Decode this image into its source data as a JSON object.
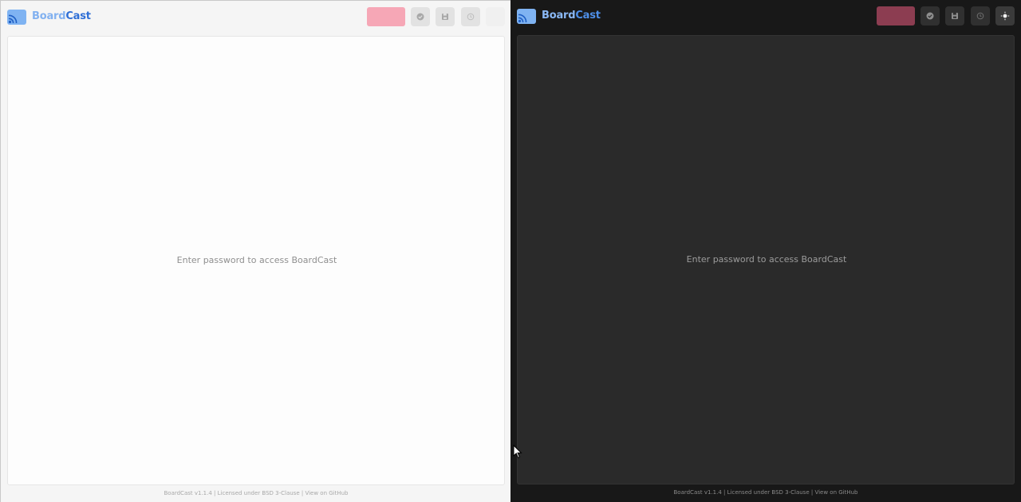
{
  "app": {
    "brand_part1": "Board",
    "brand_part2": "Cast"
  },
  "toolbar": {
    "disconnect_label": "",
    "icons": [
      "check-circle-icon",
      "save-icon",
      "history-icon"
    ]
  },
  "light_pane": {
    "theme_toggle_icon": "moon-icon",
    "theme_toggle_glyph": "❩"
  },
  "dark_pane": {
    "theme_toggle_icon": "sun-icon"
  },
  "board": {
    "message": "Enter password to access BoardCast"
  },
  "footer": {
    "version": "BoardCast v1.1.4",
    "sep1": " | ",
    "license": "Licensed under BSD 3-Clause",
    "sep2": " | ",
    "github_link": "View on GitHub"
  },
  "colors": {
    "accent_blue": "#2f6fd6",
    "disconnect_light": "#f6a7b6",
    "disconnect_dark": "#8c3d51",
    "dark_bg": "#181818",
    "dark_board": "#2a2a2a"
  }
}
